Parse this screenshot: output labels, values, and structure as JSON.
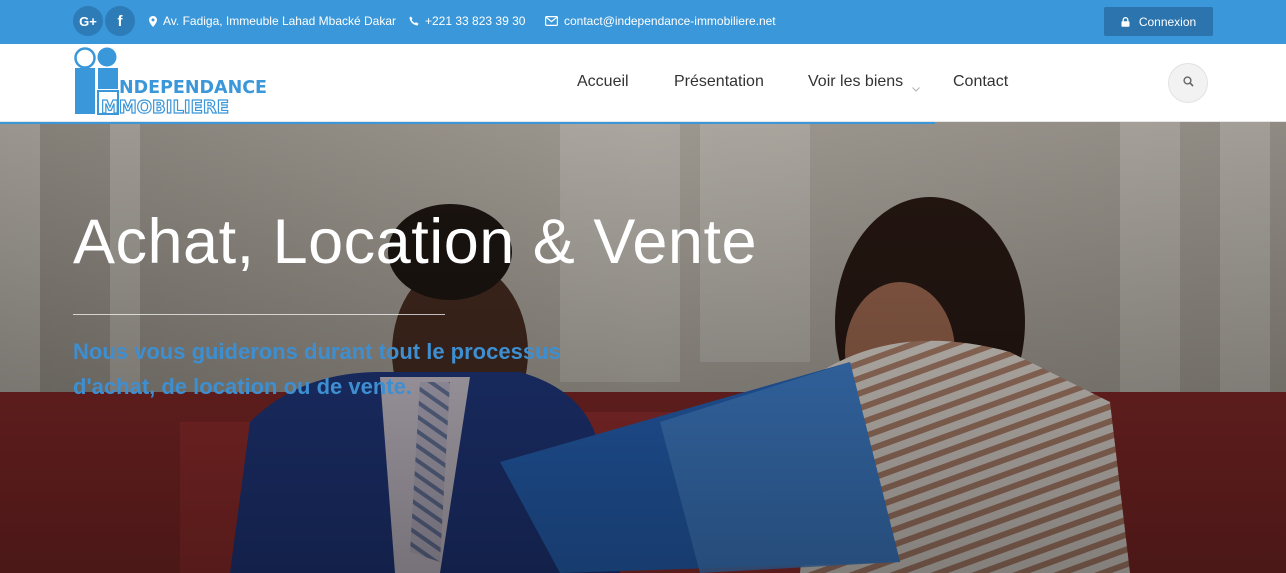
{
  "topbar": {
    "social": [
      {
        "label": "G+",
        "icon": "google-plus-icon"
      },
      {
        "label": "f",
        "icon": "facebook-icon"
      }
    ],
    "address": "Av. Fadiga, Immeuble Lahad Mbacké Dakar",
    "phone": "+221 33 823 39 30",
    "email": "contact@independance-immobiliere.net",
    "login_label": "Connexion"
  },
  "header": {
    "logo_text_top": "NDEPENDANCE",
    "logo_text_bottom": "MMOBILIERE",
    "nav": [
      {
        "label": "Accueil"
      },
      {
        "label": "Présentation"
      },
      {
        "label": "Voir les biens"
      },
      {
        "label": "Contact"
      }
    ]
  },
  "hero": {
    "title": "Achat, Location & Vente",
    "subtitle_line1": "Nous vous guiderons durant tout le processus",
    "subtitle_line2": "d'achat, de location ou de vente."
  },
  "colors": {
    "topbar": "#3a97d9",
    "accent": "#3a97d9",
    "login_button": "#2b74ad",
    "logo_blue": "#3a97d9"
  }
}
